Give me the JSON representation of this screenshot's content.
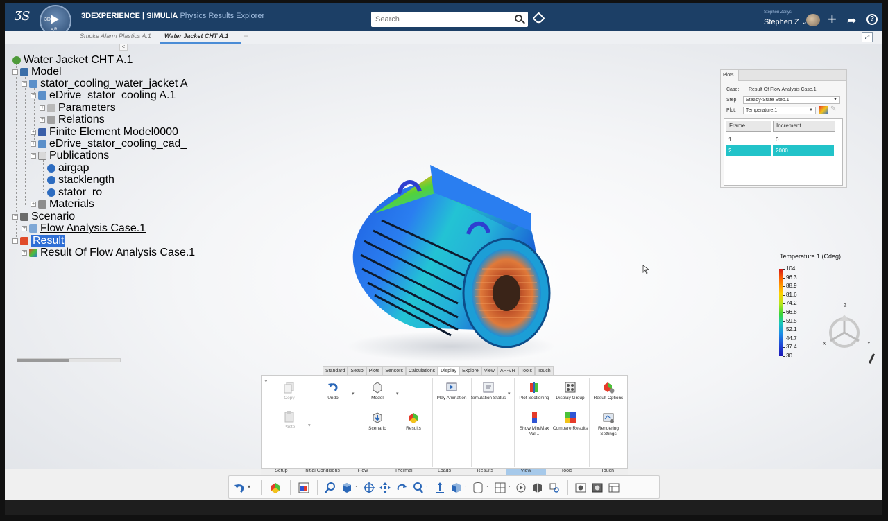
{
  "header": {
    "brand_bold": "3D",
    "brand_rest": "EXPERIENCE | SIMULIA",
    "app_name": "Physics Results Explorer",
    "compass_label": "3D",
    "compass_version": "V,R",
    "search_placeholder": "Search",
    "user_small": "Stephen Zailys",
    "user_name": "Stephen Z",
    "help": "?"
  },
  "tabs": [
    {
      "label": "Smoke Alarm Plastics A.1",
      "active": false
    },
    {
      "label": "Water Jacket CHT A.1",
      "active": true
    }
  ],
  "tree": {
    "collapse": "<",
    "items": [
      {
        "label": "Water Jacket CHT A.1",
        "icon": "product-icon"
      },
      {
        "label": "Model",
        "icon": "model-icon"
      },
      {
        "label": "stator_cooling_water_jacket A",
        "icon": "part-icon"
      },
      {
        "label": "eDrive_stator_cooling A.1",
        "icon": "part-icon"
      },
      {
        "label": "Parameters",
        "icon": "parameters-icon"
      },
      {
        "label": "Relations",
        "icon": "relations-icon"
      },
      {
        "label": "Finite Element Model0000",
        "icon": "fem-icon"
      },
      {
        "label": "eDrive_stator_cooling_cad_",
        "icon": "part-icon"
      },
      {
        "label": "Publications",
        "icon": "publications-icon"
      },
      {
        "label": "airgap",
        "icon": "publication-icon"
      },
      {
        "label": "stacklength",
        "icon": "publication-icon"
      },
      {
        "label": "stator_ro",
        "icon": "publication-icon"
      },
      {
        "label": "Materials",
        "icon": "materials-icon"
      },
      {
        "label": "Scenario",
        "icon": "scenario-icon"
      },
      {
        "label": "Flow Analysis Case.1",
        "icon": "analysis-case-icon"
      },
      {
        "label": "Result",
        "icon": "result-icon"
      },
      {
        "label": "Result Of Flow Analysis Case.1",
        "icon": "result-case-icon"
      }
    ]
  },
  "plots": {
    "tab": "Plots",
    "case_label": "Case:",
    "case_value": "Result Of Flow Analysis Case.1",
    "step_label": "Step:",
    "step_value": "Steady-State Step.1",
    "plot_label": "Plot:",
    "plot_value": "Temperature.1",
    "columns": [
      "Frame",
      "Increment"
    ],
    "rows": [
      {
        "frame": "1",
        "increment": "0"
      },
      {
        "frame": "2",
        "increment": "2000"
      }
    ]
  },
  "legend": {
    "title": "Temperature.1 (Cdeg)",
    "values": [
      "104",
      "96.3",
      "88.9",
      "81.6",
      "74.2",
      "66.8",
      "59.5",
      "52.1",
      "44.7",
      "37.4",
      "30"
    ]
  },
  "triad": {
    "x": "X",
    "y": "Y",
    "z": "Z"
  },
  "ribbon": {
    "tabs": [
      "Standard",
      "Setup",
      "Plots",
      "Sensors",
      "Calculations",
      "Display",
      "Explore",
      "View",
      "AR-VR",
      "Tools",
      "Touch"
    ],
    "active_tab": "Display",
    "buttons": {
      "copy": "Copy",
      "paste": "Paste",
      "undo": "Undo",
      "model": "Model",
      "scenario": "Scenario",
      "results": "Results",
      "play_animation": "Play Animation",
      "simulation_status": "Simulation Status",
      "plot_sectioning": "Plot Sectioning",
      "display_group": "Display Group",
      "result_options": "Result Options",
      "show_minmax": "Show Min/Max Val...",
      "compare_results": "Compare Results",
      "rendering_settings": "Rendering Settings"
    },
    "sections": [
      "Setup",
      "Initial Conditions",
      "Flow",
      "Thermal",
      "Loads",
      "Results",
      "View",
      "Tools",
      "Touch"
    ],
    "active_section": "View"
  },
  "colors": {
    "header_bg": "#1c3f66",
    "selection": "#22c3c9",
    "tree_selected": "#2f6fd6",
    "active_section": "#a6c9ea"
  }
}
